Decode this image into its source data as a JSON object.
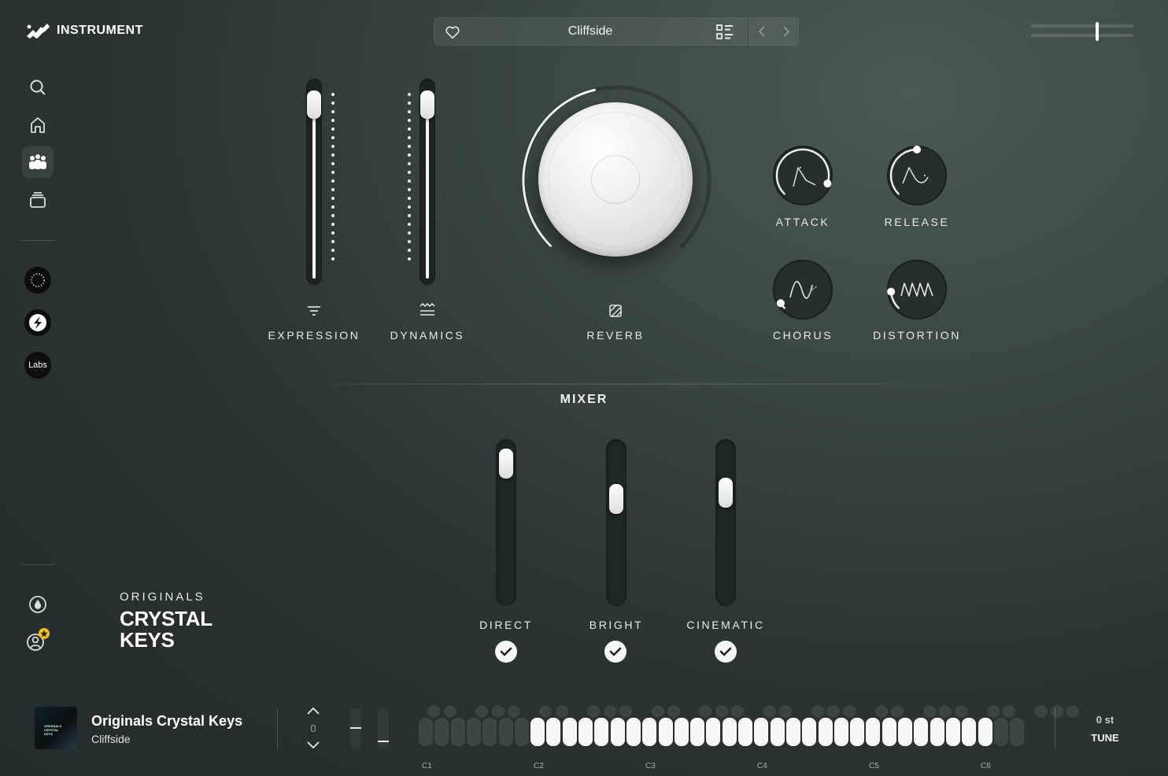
{
  "app": {
    "logo_text": "INSTRUMENT"
  },
  "preset_bar": {
    "preset_name": "Cliffside"
  },
  "master_volume": {
    "level": 0.65
  },
  "sidebar": {
    "items": [
      {
        "name": "search",
        "icon": "search-icon"
      },
      {
        "name": "home",
        "icon": "home-icon"
      },
      {
        "name": "instruments",
        "icon": "instruments-icon",
        "active": true
      },
      {
        "name": "packs",
        "icon": "layers-icon"
      }
    ],
    "brands": [
      {
        "name": "brand-circle-1",
        "icon": "brand-ring-icon"
      },
      {
        "name": "brand-circle-2",
        "icon": "brand-s-icon"
      },
      {
        "name": "brand-labs",
        "label": "Labs"
      }
    ],
    "bottom": [
      {
        "name": "drop",
        "icon": "water-drop-icon"
      },
      {
        "name": "account",
        "icon": "user-star-icon"
      }
    ]
  },
  "library": {
    "brand": "ORIGINALS",
    "name_line1": "CRYSTAL",
    "name_line2": "KEYS"
  },
  "controls": {
    "expression": {
      "label": "EXPRESSION",
      "value": 0.94
    },
    "dynamics": {
      "label": "DYNAMICS",
      "value": 0.94
    },
    "reverb": {
      "label": "REVERB",
      "value": 0.45
    },
    "attack": {
      "label": "ATTACK",
      "value": 0.9
    },
    "release": {
      "label": "RELEASE",
      "value": 0.5
    },
    "chorus": {
      "label": "CHORUS",
      "value": 0.05
    },
    "distortion": {
      "label": "DISTORTION",
      "value": 0.15
    }
  },
  "mixer": {
    "title": "MIXER",
    "channels": [
      {
        "label": "DIRECT",
        "value": 0.95,
        "enabled": true
      },
      {
        "label": "BRIGHT",
        "value": 0.68,
        "enabled": true
      },
      {
        "label": "CINEMATIC",
        "value": 0.73,
        "enabled": true
      }
    ]
  },
  "footer": {
    "instrument_name": "Originals Crystal Keys",
    "preset_name": "Cliffside",
    "artwork_text": [
      "ORIGINALS",
      "CRYSTAL",
      "KEYS"
    ],
    "octave": "0",
    "octave_labels": [
      "C1",
      "C2",
      "C3",
      "C4",
      "C5",
      "C6"
    ],
    "tune_value": "0 st",
    "tune_label": "TUNE"
  },
  "colors": {
    "accent": "#ffffff",
    "background": "#2b3335",
    "badge": "#f2c21b"
  }
}
